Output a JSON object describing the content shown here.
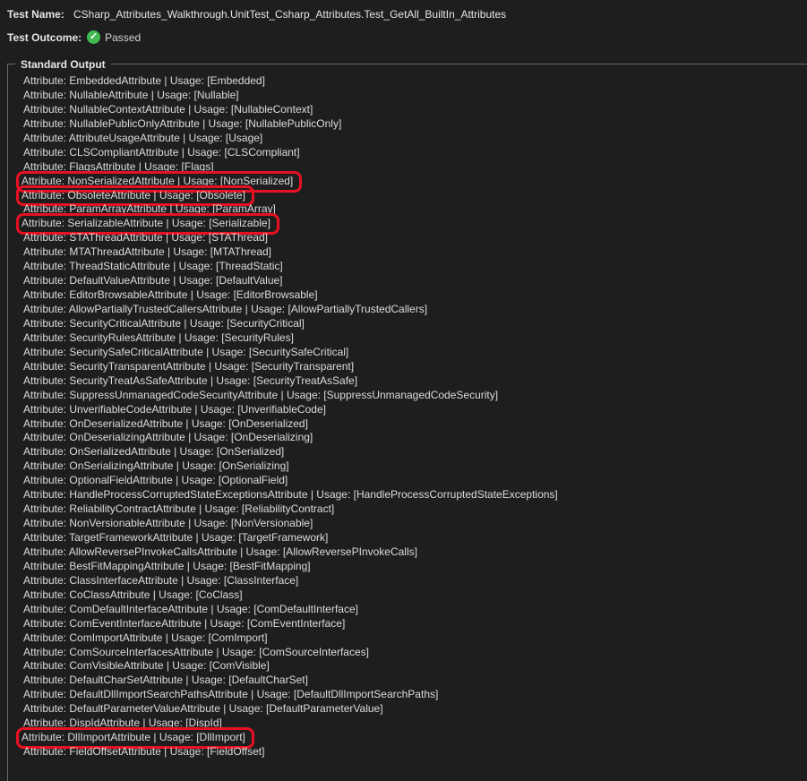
{
  "header": {
    "test_name_label": "Test Name:",
    "test_name_value": "CSharp_Attributes_Walkthrough.UnitTest_Csharp_Attributes.Test_GetAll_BuiltIn_Attributes",
    "outcome_label": "Test Outcome:",
    "outcome_icon": "check-circle-icon",
    "outcome_value": "Passed",
    "outcome_color": "#3fb950"
  },
  "output": {
    "title": "Standard Output",
    "highlight_color": "#e81123",
    "lines": [
      {
        "text": "Attribute: EmbeddedAttribute | Usage: [Embedded]",
        "highlighted": false
      },
      {
        "text": "Attribute: NullableAttribute | Usage: [Nullable]",
        "highlighted": false
      },
      {
        "text": "Attribute: NullableContextAttribute | Usage: [NullableContext]",
        "highlighted": false
      },
      {
        "text": "Attribute: NullablePublicOnlyAttribute | Usage: [NullablePublicOnly]",
        "highlighted": false
      },
      {
        "text": "Attribute: AttributeUsageAttribute | Usage: [Usage]",
        "highlighted": false
      },
      {
        "text": "Attribute: CLSCompliantAttribute | Usage: [CLSCompliant]",
        "highlighted": false
      },
      {
        "text": "Attribute: FlagsAttribute | Usage: [Flags]",
        "highlighted": false
      },
      {
        "text": "Attribute: NonSerializedAttribute | Usage: [NonSerialized]",
        "highlighted": true
      },
      {
        "text": "Attribute: ObsoleteAttribute | Usage: [Obsolete]",
        "highlighted": true
      },
      {
        "text": "Attribute: ParamArrayAttribute | Usage: [ParamArray]",
        "highlighted": false
      },
      {
        "text": "Attribute: SerializableAttribute | Usage: [Serializable]",
        "highlighted": true
      },
      {
        "text": "Attribute: STAThreadAttribute | Usage: [STAThread]",
        "highlighted": false
      },
      {
        "text": "Attribute: MTAThreadAttribute | Usage: [MTAThread]",
        "highlighted": false
      },
      {
        "text": "Attribute: ThreadStaticAttribute | Usage: [ThreadStatic]",
        "highlighted": false
      },
      {
        "text": "Attribute: DefaultValueAttribute | Usage: [DefaultValue]",
        "highlighted": false
      },
      {
        "text": "Attribute: EditorBrowsableAttribute | Usage: [EditorBrowsable]",
        "highlighted": false
      },
      {
        "text": "Attribute: AllowPartiallyTrustedCallersAttribute | Usage: [AllowPartiallyTrustedCallers]",
        "highlighted": false
      },
      {
        "text": "Attribute: SecurityCriticalAttribute | Usage: [SecurityCritical]",
        "highlighted": false
      },
      {
        "text": "Attribute: SecurityRulesAttribute | Usage: [SecurityRules]",
        "highlighted": false
      },
      {
        "text": "Attribute: SecuritySafeCriticalAttribute | Usage: [SecuritySafeCritical]",
        "highlighted": false
      },
      {
        "text": "Attribute: SecurityTransparentAttribute | Usage: [SecurityTransparent]",
        "highlighted": false
      },
      {
        "text": "Attribute: SecurityTreatAsSafeAttribute | Usage: [SecurityTreatAsSafe]",
        "highlighted": false
      },
      {
        "text": "Attribute: SuppressUnmanagedCodeSecurityAttribute | Usage: [SuppressUnmanagedCodeSecurity]",
        "highlighted": false
      },
      {
        "text": "Attribute: UnverifiableCodeAttribute | Usage: [UnverifiableCode]",
        "highlighted": false
      },
      {
        "text": "Attribute: OnDeserializedAttribute | Usage: [OnDeserialized]",
        "highlighted": false
      },
      {
        "text": "Attribute: OnDeserializingAttribute | Usage: [OnDeserializing]",
        "highlighted": false
      },
      {
        "text": "Attribute: OnSerializedAttribute | Usage: [OnSerialized]",
        "highlighted": false
      },
      {
        "text": "Attribute: OnSerializingAttribute | Usage: [OnSerializing]",
        "highlighted": false
      },
      {
        "text": "Attribute: OptionalFieldAttribute | Usage: [OptionalField]",
        "highlighted": false
      },
      {
        "text": "Attribute: HandleProcessCorruptedStateExceptionsAttribute | Usage: [HandleProcessCorruptedStateExceptions]",
        "highlighted": false
      },
      {
        "text": "Attribute: ReliabilityContractAttribute | Usage: [ReliabilityContract]",
        "highlighted": false
      },
      {
        "text": "Attribute: NonVersionableAttribute | Usage: [NonVersionable]",
        "highlighted": false
      },
      {
        "text": "Attribute: TargetFrameworkAttribute | Usage: [TargetFramework]",
        "highlighted": false
      },
      {
        "text": "Attribute: AllowReversePInvokeCallsAttribute | Usage: [AllowReversePInvokeCalls]",
        "highlighted": false
      },
      {
        "text": "Attribute: BestFitMappingAttribute | Usage: [BestFitMapping]",
        "highlighted": false
      },
      {
        "text": "Attribute: ClassInterfaceAttribute | Usage: [ClassInterface]",
        "highlighted": false
      },
      {
        "text": "Attribute: CoClassAttribute | Usage: [CoClass]",
        "highlighted": false
      },
      {
        "text": "Attribute: ComDefaultInterfaceAttribute | Usage: [ComDefaultInterface]",
        "highlighted": false
      },
      {
        "text": "Attribute: ComEventInterfaceAttribute | Usage: [ComEventInterface]",
        "highlighted": false
      },
      {
        "text": "Attribute: ComImportAttribute | Usage: [ComImport]",
        "highlighted": false
      },
      {
        "text": "Attribute: ComSourceInterfacesAttribute | Usage: [ComSourceInterfaces]",
        "highlighted": false
      },
      {
        "text": "Attribute: ComVisibleAttribute | Usage: [ComVisible]",
        "highlighted": false
      },
      {
        "text": "Attribute: DefaultCharSetAttribute | Usage: [DefaultCharSet]",
        "highlighted": false
      },
      {
        "text": "Attribute: DefaultDllImportSearchPathsAttribute | Usage: [DefaultDllImportSearchPaths]",
        "highlighted": false
      },
      {
        "text": "Attribute: DefaultParameterValueAttribute | Usage: [DefaultParameterValue]",
        "highlighted": false
      },
      {
        "text": "Attribute: DispIdAttribute | Usage: [DispId]",
        "highlighted": false
      },
      {
        "text": "Attribute: DllImportAttribute | Usage: [DllImport]",
        "highlighted": true
      },
      {
        "text": "Attribute: FieldOffsetAttribute | Usage: [FieldOffset]",
        "highlighted": false
      }
    ]
  }
}
